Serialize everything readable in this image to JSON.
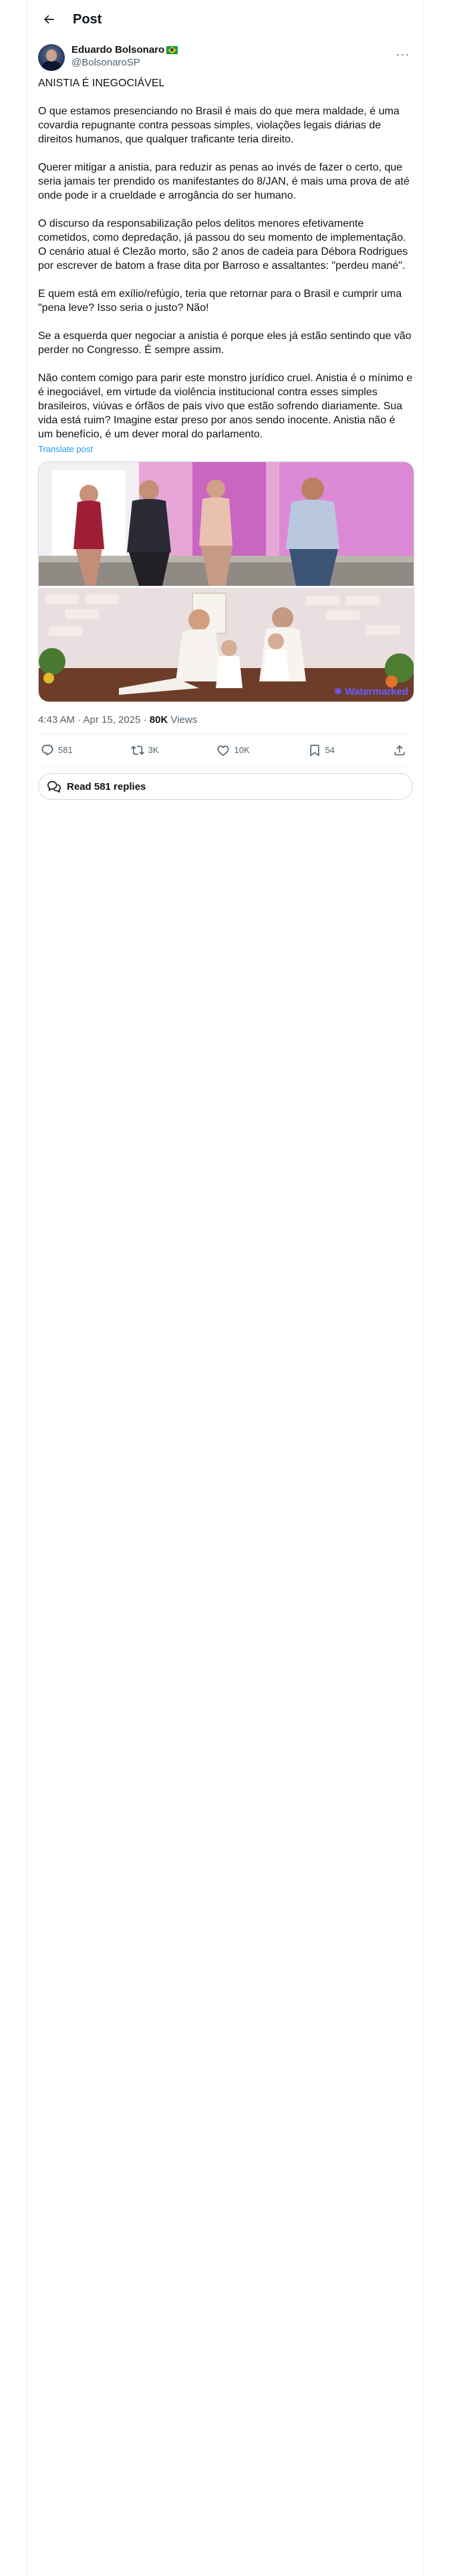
{
  "header": {
    "title": "Post",
    "back_icon": "arrow-left-icon"
  },
  "author": {
    "name": "Eduardo Bolsonaro",
    "handle": "@BolsonaroSP",
    "badge_icon": "brazil-flag-icon"
  },
  "post": {
    "paragraphs": [
      "ANISTIA É INEGOCIÁVEL",
      "O que estamos presenciando no Brasil é mais do que mera maldade, é uma covardia repugnante contra pessoas simples, violações legais diárias de direitos humanos, que qualquer traficante teria direito.",
      "Querer mitigar a anistia, para reduzir as penas ao invés de fazer o certo, que seria jamais ter prendido os manifestantes do 8/JAN, é mais uma prova de até onde pode ir a crueldade e arrogância do ser humano.",
      "O discurso da responsabilização pelos delitos menores efetivamente cometidos, como depredação, já passou do seu momento de implementação. O cenário atual é Clezão morto, são 2 anos de cadeia para Débora Rodrigues por escrever de batom a frase dita por Barroso e assaltantes: \"perdeu mané\".",
      "E quem está em exílio/refúgio, teria que retornar  para o Brasil e cumprir uma \"pena leve? Isso seria o justo? Não!",
      "Se a esquerda quer negociar a anistia é porque eles já estão sentindo que vão perder no Congresso. É sempre assim.",
      "Não contem comigo para parir este monstro jurídico cruel. Anistia é o mínimo e é inegociável, em virtude da violência institucional contra esses simples brasileiros, viúvas e órfãos de pais vivo que estão sofrendo diariamente. Sua vida está ruim? Imagine estar preso por anos sendo inocente. Anistia não é um benefício, é um dever moral do parlamento."
    ],
    "translate_label": "Translate post",
    "watermark_prefix": "✱ ",
    "watermark_text": "Watermarked",
    "time": "4:43 AM · Apr 15, 2025 · ",
    "views_count": "80K",
    "views_label": " Views"
  },
  "actions": {
    "replies": "581",
    "reposts": "3K",
    "likes": "10K",
    "bookmarks": "54"
  },
  "read_replies_label": "Read 581 replies",
  "colors": {
    "accent": "#1d9bf0",
    "muted": "#536471",
    "border": "#cfd9de"
  }
}
